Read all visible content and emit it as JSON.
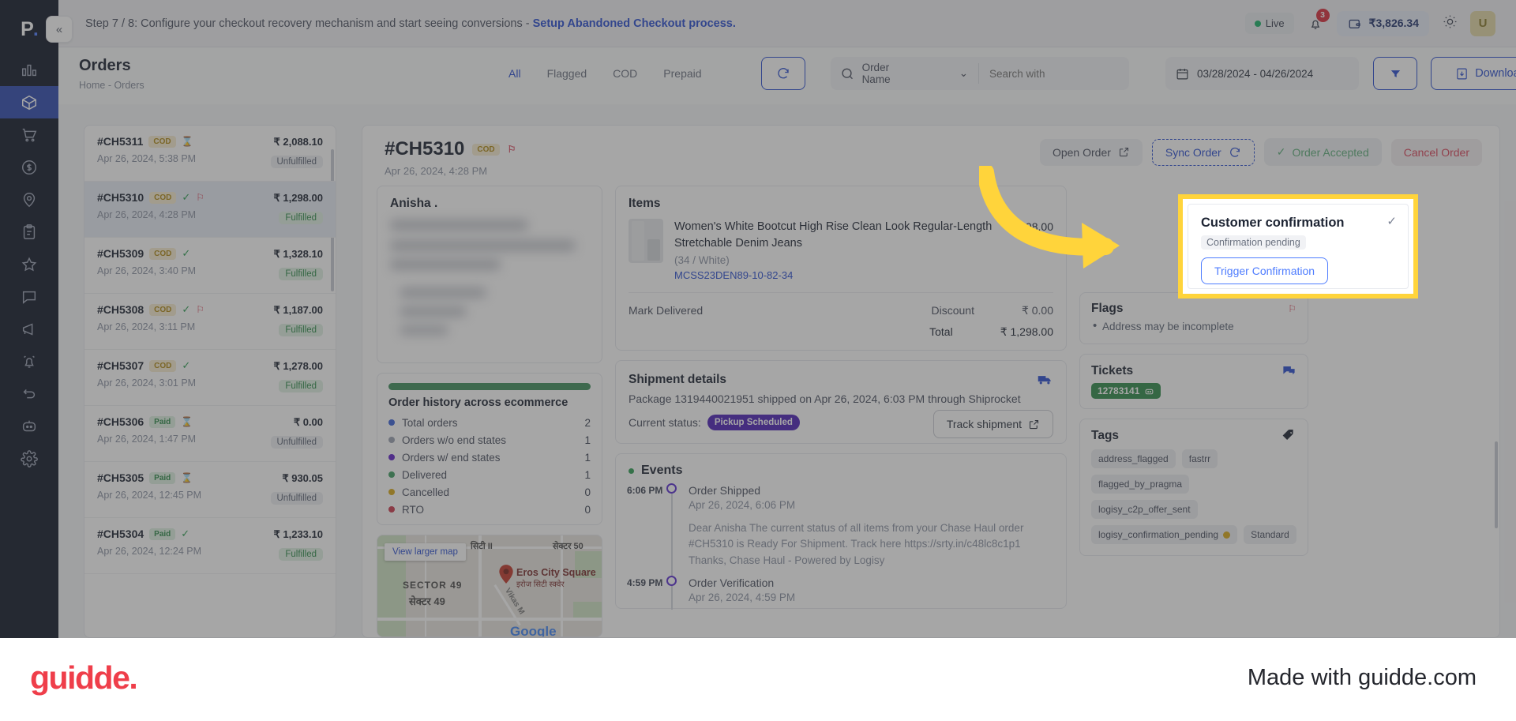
{
  "banner": {
    "text": "Step 7 / 8: Configure your checkout recovery mechanism and start seeing conversions - ",
    "link": "Setup Abandoned Checkout process.",
    "live_label": "Live",
    "notification_count": "3",
    "wallet_amount": "₹3,826.34",
    "avatar_initial": "U"
  },
  "subheader": {
    "page_title": "Orders",
    "breadcrumb": "Home - Orders",
    "tabs": [
      {
        "label": "All",
        "active": true
      },
      {
        "label": "Flagged",
        "active": false
      },
      {
        "label": "COD",
        "active": false
      },
      {
        "label": "Prepaid",
        "active": false
      }
    ],
    "search_field_label": "Order Name",
    "search_placeholder": "Search with",
    "date_range": "03/28/2024 - 04/26/2024",
    "download_label": "Download"
  },
  "orders": [
    {
      "id": "#CH5311",
      "payment": "COD",
      "payment_type": "cod",
      "check": false,
      "flag": false,
      "hourglass": true,
      "date": "Apr 26, 2024, 5:38 PM",
      "amount": "₹ 2,088.10",
      "status": "Unfulfilled",
      "status_type": "unfulfilled",
      "selected": false
    },
    {
      "id": "#CH5310",
      "payment": "COD",
      "payment_type": "cod",
      "check": true,
      "flag": true,
      "hourglass": false,
      "date": "Apr 26, 2024, 4:28 PM",
      "amount": "₹ 1,298.00",
      "status": "Fulfilled",
      "status_type": "fulfilled",
      "selected": true
    },
    {
      "id": "#CH5309",
      "payment": "COD",
      "payment_type": "cod",
      "check": true,
      "flag": false,
      "hourglass": false,
      "date": "Apr 26, 2024, 3:40 PM",
      "amount": "₹ 1,328.10",
      "status": "Fulfilled",
      "status_type": "fulfilled",
      "selected": false
    },
    {
      "id": "#CH5308",
      "payment": "COD",
      "payment_type": "cod",
      "check": true,
      "flag": true,
      "hourglass": false,
      "date": "Apr 26, 2024, 3:11 PM",
      "amount": "₹ 1,187.00",
      "status": "Fulfilled",
      "status_type": "fulfilled",
      "selected": false
    },
    {
      "id": "#CH5307",
      "payment": "COD",
      "payment_type": "cod",
      "check": true,
      "flag": false,
      "hourglass": false,
      "date": "Apr 26, 2024, 3:01 PM",
      "amount": "₹ 1,278.00",
      "status": "Fulfilled",
      "status_type": "fulfilled",
      "selected": false
    },
    {
      "id": "#CH5306",
      "payment": "Paid",
      "payment_type": "paid",
      "check": false,
      "flag": false,
      "hourglass": true,
      "date": "Apr 26, 2024, 1:47 PM",
      "amount": "₹ 0.00",
      "status": "Unfulfilled",
      "status_type": "unfulfilled",
      "selected": false
    },
    {
      "id": "#CH5305",
      "payment": "Paid",
      "payment_type": "paid",
      "check": false,
      "flag": false,
      "hourglass": true,
      "date": "Apr 26, 2024, 12:45 PM",
      "amount": "₹ 930.05",
      "status": "Unfulfilled",
      "status_type": "unfulfilled",
      "selected": false
    },
    {
      "id": "#CH5304",
      "payment": "Paid",
      "payment_type": "paid",
      "check": true,
      "flag": false,
      "hourglass": false,
      "date": "Apr 26, 2024, 12:24 PM",
      "amount": "₹ 1,233.10",
      "status": "Fulfilled",
      "status_type": "fulfilled",
      "selected": false
    }
  ],
  "detail": {
    "order_id": "#CH5310",
    "payment": "COD",
    "date": "Apr 26, 2024, 4:28 PM",
    "actions": {
      "open_order": "Open Order",
      "sync_order": "Sync Order",
      "order_accepted": "Order Accepted",
      "cancel_order": "Cancel Order"
    },
    "customer": {
      "name": "Anisha ."
    },
    "history": {
      "title": "Order history across ecommerce",
      "rows": [
        {
          "label": "Total orders",
          "value": "2",
          "color": "#3a62d8"
        },
        {
          "label": "Orders w/o end states",
          "value": "1",
          "color": "#9aa2b1"
        },
        {
          "label": "Orders w/ end states",
          "value": "1",
          "color": "#6022c9"
        },
        {
          "label": "Delivered",
          "value": "1",
          "color": "#3f9e63"
        },
        {
          "label": "Cancelled",
          "value": "0",
          "color": "#d9a918"
        },
        {
          "label": "RTO",
          "value": "0",
          "color": "#cc3a4f"
        }
      ]
    },
    "map": {
      "view_larger": "View larger map",
      "sector_en": "SECTOR 49",
      "sector_hi": "सेक्टर 49",
      "city_hi": "सिटी II",
      "sector50_hi": "सेक्टर 50",
      "poi_en": "Eros City Square",
      "poi_hi": "इरोज सिटी स्क्वेर",
      "road": "Vikas M",
      "brand": "Google"
    },
    "items": {
      "title": "Items",
      "product_name": "Women's White Bootcut High Rise Clean Look Regular-Length Stretchable Denim Jeans",
      "variant": "(34 / White)",
      "sku": "MCSS23DEN89-10-82-34",
      "price": "298.00",
      "mark_delivered": "Mark Delivered",
      "discount_label": "Discount",
      "discount_value": "₹ 0.00",
      "total_label": "Total",
      "total_value": "₹ 1,298.00"
    },
    "shipment": {
      "title": "Shipment details",
      "line": "Package 1319440021951 shipped on Apr 26, 2024, 6:03 PM through Shiprocket",
      "status_label": "Current status:",
      "status_value": "Pickup Scheduled",
      "track_label": "Track shipment"
    },
    "events": {
      "title": "Events",
      "items": [
        {
          "time": "6:06 PM",
          "name": "Order Shipped",
          "date": "Apr 26, 2024, 6:06 PM",
          "body": "Dear Anisha The current status of all items from your Chase Haul order #CH5310 is Ready For Shipment. Track here https://srty.in/c48lc8c1p1 Thanks, Chase Haul - Powered by Logisy"
        },
        {
          "time": "4:59 PM",
          "name": "Order Verification",
          "date": "Apr 26, 2024, 4:59 PM",
          "body": ""
        }
      ]
    },
    "flags": {
      "title": "Flags",
      "items": [
        "Address may be incomplete"
      ]
    },
    "tickets": {
      "title": "Tickets",
      "chip": "12783141"
    },
    "tags": {
      "title": "Tags",
      "items": [
        {
          "label": "address_flagged",
          "dot": false
        },
        {
          "label": "fastrr",
          "dot": false
        },
        {
          "label": "flagged_by_pragma",
          "dot": false
        },
        {
          "label": "logisy_c2p_offer_sent",
          "dot": false
        },
        {
          "label": "logisy_confirmation_pending",
          "dot": true
        },
        {
          "label": "Standard",
          "dot": false
        }
      ]
    }
  },
  "highlight": {
    "title": "Customer confirmation",
    "status": "Confirmation pending",
    "button": "Trigger Confirmation"
  },
  "footer": {
    "brand": "guidde.",
    "tagline": "Made with guidde.com"
  },
  "colors": {
    "accent": "#2b4fd1",
    "highlight": "#ffd43b",
    "brand_red": "#ef3e4a",
    "success": "#2f8b4a",
    "danger": "#d9455b",
    "purple": "#4d22b8"
  }
}
